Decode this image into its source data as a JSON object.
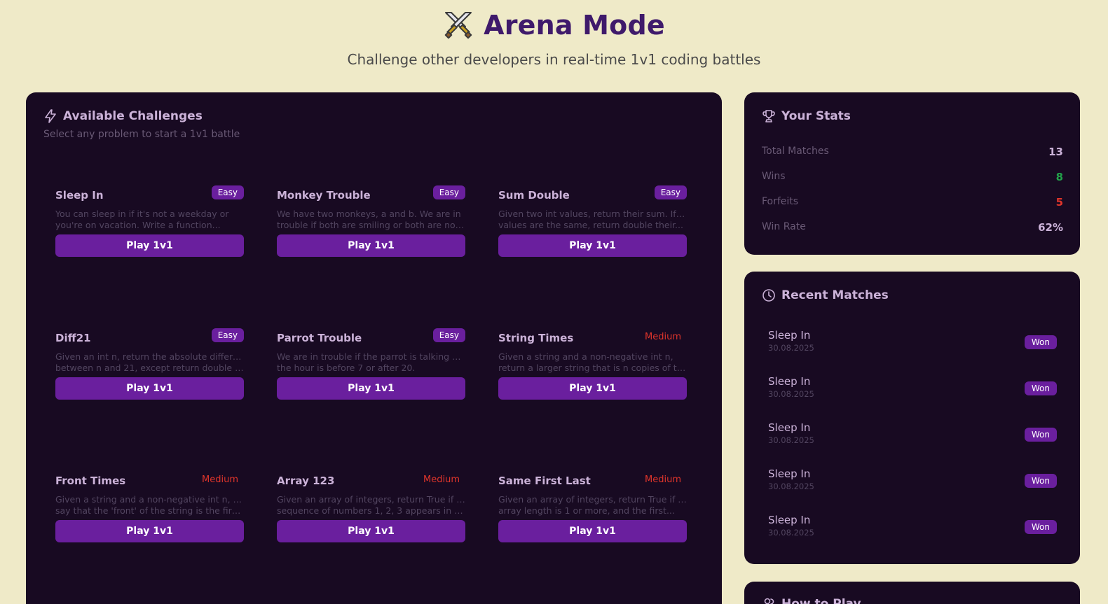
{
  "header": {
    "icon": "crossed-swords-icon",
    "title": "Arena Mode",
    "subtitle": "Challenge other developers in real-time 1v1 coding battles"
  },
  "challenges": {
    "icon": "lightning-icon",
    "title": "Available Challenges",
    "subtitle": "Select any problem to start a 1v1 battle",
    "items": [
      {
        "name": "Sleep In",
        "difficulty": "Easy",
        "desc1": "You can sleep in if it's not a weekday or",
        "desc2": "you're on vacation. Write a function...",
        "button": "Play 1v1"
      },
      {
        "name": "Monkey Trouble",
        "difficulty": "Easy",
        "desc1": "We have two monkeys, a and b. We are in",
        "desc2": "trouble if both are smiling or both are not...",
        "button": "Play 1v1"
      },
      {
        "name": "Sum Double",
        "difficulty": "Easy",
        "desc1": "Given two int values, return their sum. If the",
        "desc2": "values are the same, return double their...",
        "button": "Play 1v1"
      },
      {
        "name": "Diff21",
        "difficulty": "Easy",
        "desc1": "Given an int n, return the absolute difference",
        "desc2": "between n and 21, except return double the...",
        "button": "Play 1v1"
      },
      {
        "name": "Parrot Trouble",
        "difficulty": "Easy",
        "desc1": "We are in trouble if the parrot is talking and",
        "desc2": "the hour is before 7 or after 20.",
        "button": "Play 1v1"
      },
      {
        "name": "String Times",
        "difficulty": "Medium",
        "desc1": "Given a string and a non-negative int n,",
        "desc2": "return a larger string that is n copies of the...",
        "button": "Play 1v1"
      },
      {
        "name": "Front Times",
        "difficulty": "Medium",
        "desc1": "Given a string and a non-negative int n, we'll",
        "desc2": "say that the 'front' of the string is the first 3...",
        "button": "Play 1v1"
      },
      {
        "name": "Array 123",
        "difficulty": "Medium",
        "desc1": "Given an array of integers, return True if the",
        "desc2": "sequence of numbers 1, 2, 3 appears in the...",
        "button": "Play 1v1"
      },
      {
        "name": "Same First Last",
        "difficulty": "Medium",
        "desc1": "Given an array of integers, return True if the",
        "desc2": "array length is 1 or more, and the first...",
        "button": "Play 1v1"
      }
    ]
  },
  "stats": {
    "icon": "trophy-icon",
    "title": "Your Stats",
    "rows": [
      {
        "label": "Total Matches",
        "value": "13",
        "color": "#cbb2d8"
      },
      {
        "label": "Wins",
        "value": "8",
        "color": "#22a34a"
      },
      {
        "label": "Forfeits",
        "value": "5",
        "color": "#e0352b"
      },
      {
        "label": "Win Rate",
        "value": "62%",
        "color": "#cbb2d8"
      }
    ]
  },
  "recent": {
    "icon": "clock-icon",
    "title": "Recent Matches",
    "matches": [
      {
        "name": "Sleep In",
        "date": "30.08.2025",
        "result": "Won"
      },
      {
        "name": "Sleep In",
        "date": "30.08.2025",
        "result": "Won"
      },
      {
        "name": "Sleep In",
        "date": "30.08.2025",
        "result": "Won"
      },
      {
        "name": "Sleep In",
        "date": "30.08.2025",
        "result": "Won"
      },
      {
        "name": "Sleep In",
        "date": "30.08.2025",
        "result": "Won"
      }
    ]
  },
  "howto": {
    "icon": "users-icon",
    "title": "How to Play"
  },
  "colors": {
    "page_bg": "#efeac8",
    "panel_bg": "#180a22",
    "accent": "#6a1f9e",
    "title": "#3f1a6b",
    "medium": "#e0352b",
    "win": "#22a34a"
  }
}
